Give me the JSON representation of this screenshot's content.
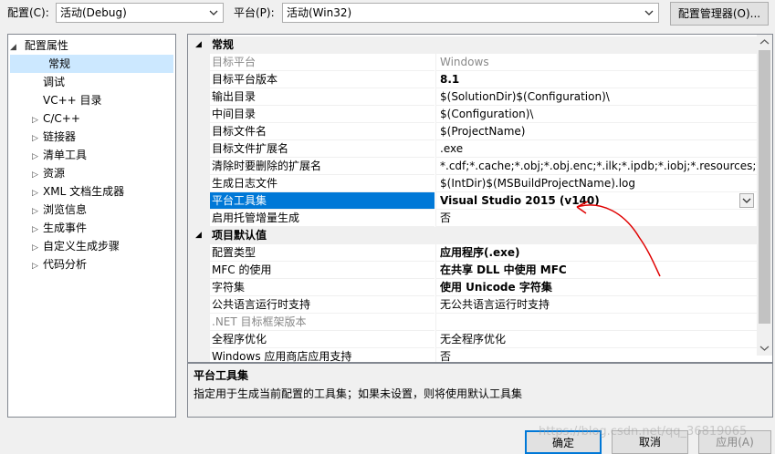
{
  "toolbar": {
    "config_label": "配置(C):",
    "config_value": "活动(Debug)",
    "platform_label": "平台(P):",
    "platform_value": "活动(Win32)",
    "config_manager": "配置管理器(O)..."
  },
  "tree": {
    "root": "配置属性",
    "items": [
      {
        "label": "常规",
        "expandable": false,
        "selected": true
      },
      {
        "label": "调试",
        "expandable": false
      },
      {
        "label": "VC++ 目录",
        "expandable": false
      },
      {
        "label": "C/C++",
        "expandable": true
      },
      {
        "label": "链接器",
        "expandable": true
      },
      {
        "label": "清单工具",
        "expandable": true
      },
      {
        "label": "资源",
        "expandable": true
      },
      {
        "label": "XML 文档生成器",
        "expandable": true
      },
      {
        "label": "浏览信息",
        "expandable": true
      },
      {
        "label": "生成事件",
        "expandable": true
      },
      {
        "label": "自定义生成步骤",
        "expandable": true
      },
      {
        "label": "代码分析",
        "expandable": true
      }
    ]
  },
  "grid": {
    "cat_general": "常规",
    "cat_defaults": "项目默认值",
    "general_rows": [
      {
        "name": "目标平台",
        "value": "Windows",
        "disabled": true
      },
      {
        "name": "目标平台版本",
        "value": "8.1",
        "bold": true
      },
      {
        "name": "输出目录",
        "value": "$(SolutionDir)$(Configuration)\\"
      },
      {
        "name": "中间目录",
        "value": "$(Configuration)\\"
      },
      {
        "name": "目标文件名",
        "value": "$(ProjectName)"
      },
      {
        "name": "目标文件扩展名",
        "value": ".exe"
      },
      {
        "name": "清除时要删除的扩展名",
        "value": "*.cdf;*.cache;*.obj;*.obj.enc;*.ilk;*.ipdb;*.iobj;*.resources;*.tlb;*."
      },
      {
        "name": "生成日志文件",
        "value": "$(IntDir)$(MSBuildProjectName).log"
      },
      {
        "name": "平台工具集",
        "value": "Visual Studio 2015 (v140)",
        "bold": true,
        "selected": true
      },
      {
        "name": "启用托管增量生成",
        "value": "否"
      }
    ],
    "default_rows": [
      {
        "name": "配置类型",
        "value": "应用程序(.exe)",
        "bold": true
      },
      {
        "name": "MFC 的使用",
        "value": "在共享 DLL 中使用 MFC",
        "bold": true
      },
      {
        "name": "字符集",
        "value": "使用 Unicode 字符集",
        "bold": true
      },
      {
        "name": "公共语言运行时支持",
        "value": "无公共语言运行时支持"
      },
      {
        "name": ".NET 目标框架版本",
        "value": "",
        "disabled": true
      },
      {
        "name": "全程序优化",
        "value": "无全程序优化"
      },
      {
        "name": "Windows 应用商店应用支持",
        "value": "否"
      }
    ]
  },
  "description": {
    "title": "平台工具集",
    "text": "指定用于生成当前配置的工具集；如果未设置，则将使用默认工具集"
  },
  "buttons": {
    "ok": "确定",
    "cancel": "取消",
    "apply": "应用(A)"
  },
  "watermark": "https://blog.csdn.net/qq_36819065",
  "colors": {
    "selection": "#0078d7",
    "tree_selection": "#cce8ff",
    "annotation": "#e00000"
  }
}
